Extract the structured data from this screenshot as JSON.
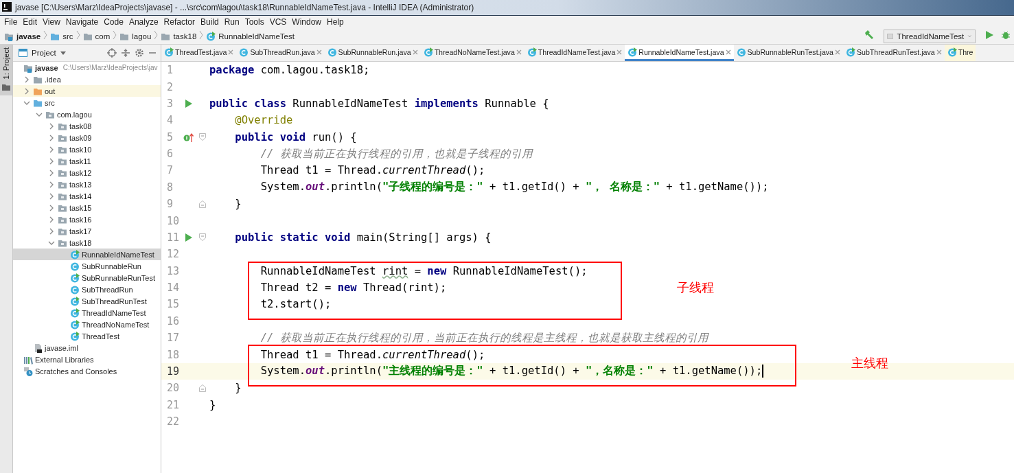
{
  "window": {
    "title": "javase [C:\\Users\\Marz\\IdeaProjects\\javase] - ...\\src\\com\\lagou\\task18\\RunnableIdNameTest.java - IntelliJ IDEA (Administrator)"
  },
  "menu": [
    "File",
    "Edit",
    "View",
    "Navigate",
    "Code",
    "Analyze",
    "Refactor",
    "Build",
    "Run",
    "Tools",
    "VCS",
    "Window",
    "Help"
  ],
  "breadcrumbs": [
    {
      "label": "javase",
      "kind": "module"
    },
    {
      "label": "src",
      "kind": "source"
    },
    {
      "label": "com",
      "kind": "folder"
    },
    {
      "label": "lagou",
      "kind": "folder"
    },
    {
      "label": "task18",
      "kind": "folder"
    },
    {
      "label": "RunnableIdNameTest",
      "kind": "runnable-class"
    }
  ],
  "run_config": {
    "label": "ThreadIdNameTest"
  },
  "side_strip": {
    "label": "1: Project"
  },
  "project_panel": {
    "title": "Project"
  },
  "tree": [
    {
      "label": "javase",
      "kind": "module",
      "detail": "C:\\Users\\Marz\\IdeaProjects\\jav",
      "selected": false,
      "children": [
        {
          "label": ".idea",
          "kind": "folder",
          "expanded": false,
          "selected": false
        },
        {
          "label": "out",
          "kind": "excluded",
          "expanded": false,
          "selected": false
        },
        {
          "label": "src",
          "kind": "source",
          "expanded": true,
          "selected": false,
          "children": [
            {
              "label": "com.lagou",
              "kind": "package",
              "expanded": true,
              "selected": false,
              "children": [
                {
                  "label": "task08",
                  "kind": "package",
                  "expanded": false,
                  "selected": false
                },
                {
                  "label": "task09",
                  "kind": "package",
                  "expanded": false,
                  "selected": false
                },
                {
                  "label": "task10",
                  "kind": "package",
                  "expanded": false,
                  "selected": false
                },
                {
                  "label": "task11",
                  "kind": "package",
                  "expanded": false,
                  "selected": false
                },
                {
                  "label": "task12",
                  "kind": "package",
                  "expanded": false,
                  "selected": false
                },
                {
                  "label": "task13",
                  "kind": "package",
                  "expanded": false,
                  "selected": false
                },
                {
                  "label": "task14",
                  "kind": "package",
                  "expanded": false,
                  "selected": false
                },
                {
                  "label": "task15",
                  "kind": "package",
                  "expanded": false,
                  "selected": false
                },
                {
                  "label": "task16",
                  "kind": "package",
                  "expanded": false,
                  "selected": false
                },
                {
                  "label": "task17",
                  "kind": "package",
                  "expanded": false,
                  "selected": false
                },
                {
                  "label": "task18",
                  "kind": "package",
                  "expanded": true,
                  "selected": false,
                  "children": [
                    {
                      "label": "RunnableIdNameTest",
                      "kind": "runnable-class",
                      "selected": true
                    },
                    {
                      "label": "SubRunnableRun",
                      "kind": "class",
                      "selected": false
                    },
                    {
                      "label": "SubRunnableRunTest",
                      "kind": "runnable-class",
                      "selected": false
                    },
                    {
                      "label": "SubThreadRun",
                      "kind": "class",
                      "selected": false
                    },
                    {
                      "label": "SubThreadRunTest",
                      "kind": "runnable-class",
                      "selected": false
                    },
                    {
                      "label": "ThreadIdNameTest",
                      "kind": "runnable-class",
                      "selected": false
                    },
                    {
                      "label": "ThreadNoNameTest",
                      "kind": "runnable-class",
                      "selected": false
                    },
                    {
                      "label": "ThreadTest",
                      "kind": "runnable-class",
                      "selected": false
                    }
                  ]
                }
              ]
            }
          ]
        },
        {
          "label": "javase.iml",
          "kind": "iml",
          "selected": false
        }
      ]
    },
    {
      "label": "External Libraries",
      "kind": "libraries",
      "selected": false
    },
    {
      "label": "Scratches and Consoles",
      "kind": "scratches",
      "selected": false
    }
  ],
  "tabs": [
    {
      "label": "ThreadTest.java",
      "kind": "runnable-class",
      "selected": false,
      "closable": true
    },
    {
      "label": "SubThreadRun.java",
      "kind": "class",
      "selected": false,
      "closable": true
    },
    {
      "label": "SubRunnableRun.java",
      "kind": "class",
      "selected": false,
      "closable": true
    },
    {
      "label": "ThreadNoNameTest.java",
      "kind": "runnable-class",
      "selected": false,
      "closable": true
    },
    {
      "label": "ThreadIdNameTest.java",
      "kind": "runnable-class",
      "selected": false,
      "closable": true
    },
    {
      "label": "RunnableIdNameTest.java",
      "kind": "runnable-class",
      "selected": true,
      "closable": true
    },
    {
      "label": "SubRunnableRunTest.java",
      "kind": "class",
      "selected": false,
      "closable": true
    },
    {
      "label": "SubThreadRunTest.java",
      "kind": "runnable-class",
      "selected": false,
      "closable": true
    },
    {
      "label": "Thre",
      "kind": "runnable-class",
      "selected": false,
      "closable": false
    }
  ],
  "code": [
    {
      "lines": [
        {
          "number": "1",
          "current": false,
          "tokens": [
            {
              "kind": "kw",
              "text": "package"
            },
            {
              "kind": "plain",
              "text": " com.lagou.task18;"
            }
          ]
        },
        {
          "number": "2",
          "current": false
        },
        {
          "number": "3",
          "current": false,
          "gutter": {
            "kind": "run"
          },
          "tokens": [
            {
              "kind": "kw",
              "text": "public class"
            },
            {
              "kind": "plain",
              "text": " RunnableIdNameTest "
            },
            {
              "kind": "kw",
              "text": "implements"
            },
            {
              "kind": "plain",
              "text": " Runnable {"
            }
          ]
        },
        {
          "number": "4",
          "current": false,
          "tokens": [
            {
              "kind": "annotation",
              "text": "    @Override"
            }
          ]
        },
        {
          "number": "5",
          "current": false,
          "gutter": {
            "kind": "override"
          },
          "fold": {
            "kind": "start"
          },
          "tokens": [
            {
              "kind": "kw",
              "text": "    public void"
            },
            {
              "kind": "plain",
              "text": " run() {"
            }
          ]
        },
        {
          "number": "6",
          "current": false,
          "tokens": [
            {
              "kind": "comment",
              "text": "        // 获取当前正在执行线程的引用，也就是子线程的引用"
            }
          ]
        },
        {
          "number": "7",
          "current": false,
          "tokens": [
            {
              "kind": "plain",
              "text": "        Thread t1 = Thread."
            },
            {
              "kind": "italic",
              "text": "currentThread"
            },
            {
              "kind": "plain",
              "text": "();"
            }
          ]
        },
        {
          "number": "8",
          "current": false,
          "tokens": [
            {
              "kind": "plain",
              "text": "        System."
            },
            {
              "kind": "field",
              "text": "out"
            },
            {
              "kind": "plain",
              "text": ".println("
            },
            {
              "kind": "str",
              "text": "\"子线程的编号是：\""
            },
            {
              "kind": "plain",
              "text": " + t1.getId() + "
            },
            {
              "kind": "str",
              "text": "\"， 名称是：\""
            },
            {
              "kind": "plain",
              "text": " + t1.getName());"
            }
          ]
        },
        {
          "number": "9",
          "current": false,
          "fold": {
            "kind": "end"
          },
          "tokens": [
            {
              "kind": "plain",
              "text": "    }"
            }
          ]
        },
        {
          "number": "10",
          "current": false
        },
        {
          "number": "11",
          "current": false,
          "gutter": {
            "kind": "run"
          },
          "fold": {
            "kind": "start"
          },
          "tokens": [
            {
              "kind": "kw",
              "text": "    public static void"
            },
            {
              "kind": "plain",
              "text": " main(String[] args) {"
            }
          ]
        },
        {
          "number": "12",
          "current": false
        }
      ]
    },
    {
      "box": {
        "label": "子线程"
      },
      "lines": [
        {
          "number": "13",
          "current": false,
          "tokens": [
            {
              "kind": "plain",
              "text": "        RunnableIdNameTest "
            },
            {
              "kind": "warn",
              "text": "rint"
            },
            {
              "kind": "plain",
              "text": " = "
            },
            {
              "kind": "kw",
              "text": "new"
            },
            {
              "kind": "plain",
              "text": " RunnableIdNameTest();"
            }
          ]
        },
        {
          "number": "14",
          "current": false,
          "tokens": [
            {
              "kind": "plain",
              "text": "        Thread t2 = "
            },
            {
              "kind": "kw",
              "text": "new"
            },
            {
              "kind": "plain",
              "text": " Thread(rint);"
            }
          ]
        },
        {
          "number": "15",
          "current": false,
          "tokens": [
            {
              "kind": "plain",
              "text": "        t2.start();"
            }
          ]
        }
      ]
    },
    {
      "lines": [
        {
          "number": "16",
          "current": false
        },
        {
          "number": "17",
          "current": false,
          "tokens": [
            {
              "kind": "comment",
              "text": "        // 获取当前正在执行线程的引用，当前正在执行的线程是主线程，也就是获取主线程的引用"
            }
          ]
        }
      ]
    },
    {
      "box": {
        "label": "主线程"
      },
      "lines": [
        {
          "number": "18",
          "current": false,
          "tokens": [
            {
              "kind": "plain",
              "text": "        Thread t1 = Thread."
            },
            {
              "kind": "italic",
              "text": "currentThread"
            },
            {
              "kind": "plain",
              "text": "();"
            }
          ]
        },
        {
          "number": "19",
          "current": true,
          "tokens": [
            {
              "kind": "plain",
              "text": "        System."
            },
            {
              "kind": "field",
              "text": "out"
            },
            {
              "kind": "plain",
              "text": ".println("
            },
            {
              "kind": "str",
              "text": "\"主线程的编号是：\""
            },
            {
              "kind": "plain",
              "text": " + t1.getId() + "
            },
            {
              "kind": "str",
              "text": "\"，名称是：\""
            },
            {
              "kind": "plain",
              "text": " + t1.getName());"
            }
          ]
        }
      ]
    },
    {
      "lines": [
        {
          "number": "20",
          "current": false,
          "fold": {
            "kind": "end"
          },
          "tokens": [
            {
              "kind": "plain",
              "text": "    }"
            }
          ]
        },
        {
          "number": "21",
          "current": false,
          "tokens": [
            {
              "kind": "plain",
              "text": "}"
            }
          ]
        },
        {
          "number": "22",
          "current": false
        }
      ]
    }
  ]
}
